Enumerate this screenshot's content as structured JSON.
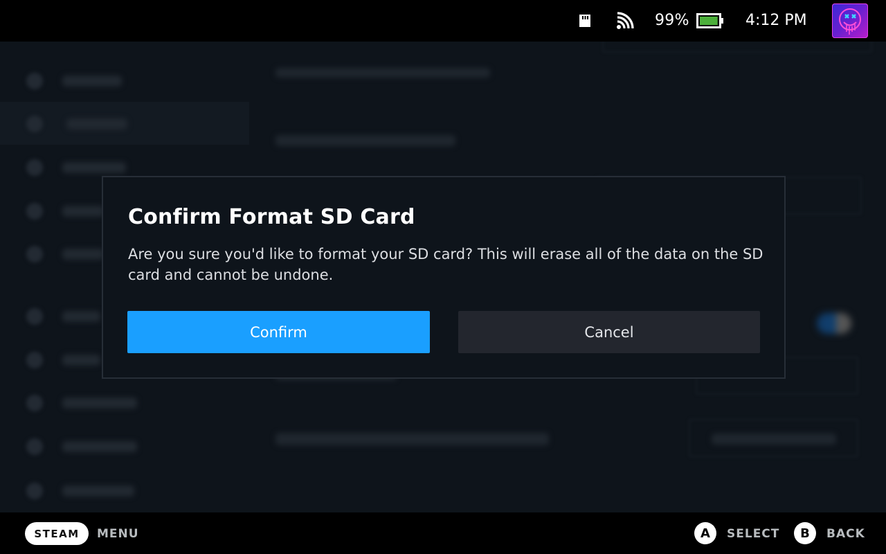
{
  "status_bar": {
    "icons": [
      "sd-card-icon",
      "wifi-icon",
      "battery-icon"
    ],
    "battery_percent": "99%",
    "battery_level": 0.99,
    "battery_color": "#4caf3a",
    "time": "4:12 PM",
    "avatar": "neon-smiley-avatar"
  },
  "background_page": {
    "section": "System",
    "sidebar_items": [
      {
        "label": "General",
        "icon": "gear-icon"
      },
      {
        "label": "System",
        "icon": "system-icon",
        "active": true
      },
      {
        "label": "Security",
        "icon": "lock-icon"
      },
      {
        "label": "Internet",
        "icon": "wifi-icon"
      },
      {
        "label": "Notifications",
        "icon": "bell-icon"
      },
      {
        "label": "Display",
        "icon": "display-icon"
      },
      {
        "label": "Audio",
        "icon": "speaker-icon"
      },
      {
        "label": "Bluetooth",
        "icon": "bluetooth-icon"
      },
      {
        "label": "Controller",
        "icon": "controller-icon"
      },
      {
        "label": "Keyboard",
        "icon": "keyboard-icon"
      }
    ]
  },
  "dialog": {
    "title": "Confirm Format SD Card",
    "body": "Are you sure you'd like to format your SD card? This will erase all of the data on the SD card and cannot be undone.",
    "confirm_label": "Confirm",
    "cancel_label": "Cancel",
    "confirm_color": "#1a9fff",
    "cancel_color": "#23262e"
  },
  "footer": {
    "steam_label": "STEAM",
    "menu_label": "MENU",
    "a_glyph": "A",
    "select_label": "SELECT",
    "b_glyph": "B",
    "back_label": "BACK"
  }
}
